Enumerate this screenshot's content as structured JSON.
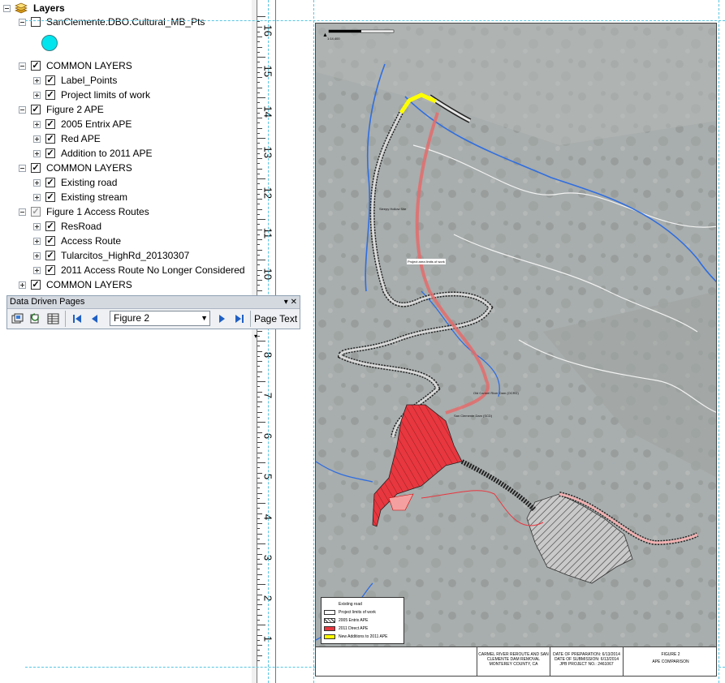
{
  "toc": {
    "root_label": "Layers",
    "items": [
      {
        "label": "SanClemente.DBO.Cultural_MB_Pts",
        "checked": false,
        "level": 1
      },
      {
        "label": "COMMON LAYERS",
        "checked": true,
        "level": 1
      },
      {
        "label": "Label_Points",
        "checked": true,
        "level": 2
      },
      {
        "label": "Project limits of work",
        "checked": true,
        "level": 2
      },
      {
        "label": "Figure 2 APE",
        "checked": true,
        "level": 1
      },
      {
        "label": "2005 Entrix APE",
        "checked": true,
        "level": 2
      },
      {
        "label": "Red APE",
        "checked": true,
        "level": 2
      },
      {
        "label": "Addition to 2011 APE",
        "checked": true,
        "level": 2
      },
      {
        "label": "COMMON LAYERS",
        "checked": true,
        "level": 1
      },
      {
        "label": "Existing road",
        "checked": true,
        "level": 2
      },
      {
        "label": "Existing stream",
        "checked": true,
        "level": 2
      },
      {
        "label": "Figure 1 Access Routes",
        "checked": "partial",
        "level": 1
      },
      {
        "label": "ResRoad",
        "checked": true,
        "level": 2
      },
      {
        "label": "Access Route",
        "checked": true,
        "level": 2
      },
      {
        "label": "Tularcitos_HighRd_20130307",
        "checked": true,
        "level": 2
      },
      {
        "label": "2011 Access Route No Longer Considered",
        "checked": true,
        "level": 2
      },
      {
        "label": "COMMON LAYERS",
        "checked": true,
        "level": 1
      }
    ],
    "symbol_color": "#00e5ee"
  },
  "ddp_toolbar": {
    "title": "Data Driven Pages",
    "page_value": "Figure 2",
    "page_text_label": "Page Text"
  },
  "ruler": {
    "labels": [
      "16",
      "15",
      "14",
      "13",
      "12",
      "11",
      "10",
      "9",
      "8",
      "7",
      "6",
      "5",
      "4",
      "3",
      "2",
      "1"
    ]
  },
  "map": {
    "labels": {
      "project_limits": "Project area limits of work",
      "sleepy_hollow": "Sleepy Hollow Site",
      "old_carmel": "Old Carmel River Dam (OCRD)",
      "san_clemente": "San Clemente Dam (SCD)"
    },
    "scale_label": "1:14,400",
    "colors": {
      "red_ape": "#e8373f",
      "yellow": "#ffff00",
      "stream": "#2f6ee0",
      "imagery": "#a9aeae"
    }
  },
  "legend": {
    "items": [
      "Existing road",
      "Project limits of work",
      "2005 Entrix APE",
      "2011 Direct APE",
      "New Additions to 2011 APE"
    ]
  },
  "title_block": {
    "project": "CARMEL RIVER REROUTE AND SAN CLEMENTE DAM REMOVAL MONTEREY COUNTY, CA",
    "dates": "DATE OF PREPARATION: 6/13/2014 DATE OF SUBMISSION: 6/13/2014 JPB PROJECT NO.: 2461067",
    "figure_no": "FIGURE 2",
    "figure_title": "APE COMPARISON"
  }
}
